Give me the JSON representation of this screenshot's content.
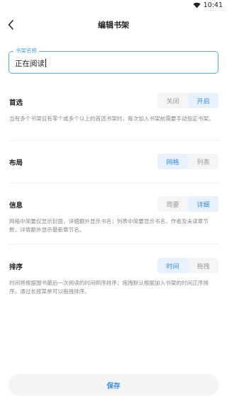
{
  "status_bar": {
    "time": "10:41",
    "wifi_icon": "wifi-icon"
  },
  "header": {
    "title": "编辑书架",
    "back_icon": "chevron-left-icon"
  },
  "name_field": {
    "label": "书架名称",
    "value": "正在阅读"
  },
  "sections": {
    "preferred": {
      "title": "首选",
      "options": [
        "关闭",
        "开启"
      ],
      "selected": "开启",
      "description": "当有多个书架且有零个或多个以上的首选书架时，每次加入书架前需要手动指定书架。"
    },
    "layout": {
      "title": "布局",
      "options": [
        "网格",
        "列表"
      ],
      "selected": "网格"
    },
    "info": {
      "title": "信息",
      "options": [
        "简要",
        "详细"
      ],
      "selected": "详细",
      "description": "网格中简要仅显示封面，详细额外显示书名；列表中简要显示书名、作者及未读章节数，详情额外显示最新章节名。"
    },
    "sort": {
      "title": "排序",
      "options": [
        "时间",
        "拖拽"
      ],
      "selected": "时间",
      "description": "时间将根据图书最后一次阅读的时间倒序排序；拖拽默认根据加入书架的时间正序排序，通过长按菜单可以拖拽排序。"
    }
  },
  "footer": {
    "save_label": "保存"
  },
  "colors": {
    "accent": "#3d8ee6",
    "active_bg": "#e6f1fd",
    "field_border": "#5aa7ee"
  }
}
